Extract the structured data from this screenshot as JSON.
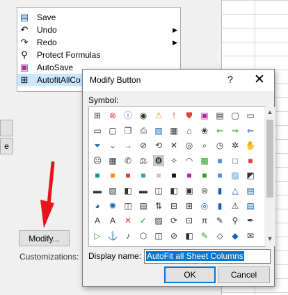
{
  "commands": [
    {
      "label": "Save",
      "icon": "save-icon"
    },
    {
      "label": "Undo",
      "icon": "undo-icon"
    },
    {
      "label": "Redo",
      "icon": "redo-icon"
    },
    {
      "label": "Protect Formulas",
      "icon": "protect-formulas-icon"
    },
    {
      "label": "AutoSave",
      "icon": "autosave-icon"
    },
    {
      "label": "AutofitAllCo",
      "icon": "flowchart-icon"
    }
  ],
  "side_button_label": "e",
  "modify_label": "Modify...",
  "customizations_label": "Customizations:",
  "dialog": {
    "title": "Modify Button",
    "help": "?",
    "close": "✕",
    "symbol_label": "Symbol:",
    "display_name_label": "Display name:",
    "display_name_value": "AutoFit all Sheet Columns",
    "ok_label": "OK",
    "cancel_label": "Cancel"
  },
  "symbols": [
    {
      "g": "⊞",
      "c": "#333"
    },
    {
      "g": "⊗",
      "c": "#e04040"
    },
    {
      "g": "ⓘ",
      "c": "#1a5fb4"
    },
    {
      "g": "◉",
      "c": "#333"
    },
    {
      "g": "⚠",
      "c": "#d9a400"
    },
    {
      "g": "!",
      "c": "#e04040"
    },
    {
      "g": "⛊",
      "c": "#e04040"
    },
    {
      "g": "▣",
      "c": "#b0289a"
    },
    {
      "g": "▤",
      "c": "#333"
    },
    {
      "g": "▢",
      "c": "#333"
    },
    {
      "g": "▭",
      "c": "#333"
    },
    {
      "g": "▭",
      "c": "#333"
    },
    {
      "g": "▢",
      "c": "#333"
    },
    {
      "g": "❐",
      "c": "#333"
    },
    {
      "g": "⎙",
      "c": "#333"
    },
    {
      "g": "▧",
      "c": "#1a5fb4"
    },
    {
      "g": "▦",
      "c": "#333"
    },
    {
      "g": "⌂",
      "c": "#333"
    },
    {
      "g": "❀",
      "c": "#333"
    },
    {
      "g": "⇐",
      "c": "#2aa02a"
    },
    {
      "g": "⇒",
      "c": "#2aa02a"
    },
    {
      "g": "⇐",
      "c": "#1a5fb4"
    },
    {
      "g": "⏷",
      "c": "#1a5fb4"
    },
    {
      "g": "⌄",
      "c": "#1a5fb4"
    },
    {
      "g": "→",
      "c": "#1a5fb4"
    },
    {
      "g": "⊘",
      "c": "#333"
    },
    {
      "g": "⟲",
      "c": "#333"
    },
    {
      "g": "✕",
      "c": "#333"
    },
    {
      "g": "◎",
      "c": "#333"
    },
    {
      "g": "⌕",
      "c": "#333"
    },
    {
      "g": "◷",
      "c": "#333"
    },
    {
      "g": "✲",
      "c": "#333"
    },
    {
      "g": "✋",
      "c": "#333"
    },
    {
      "g": "☹",
      "c": "#333"
    },
    {
      "g": "▦",
      "c": "#333"
    },
    {
      "g": "✆",
      "c": "#333"
    },
    {
      "g": "⚖",
      "c": "#333"
    },
    {
      "g": "❽",
      "c": "#333"
    },
    {
      "g": "✧",
      "c": "#333"
    },
    {
      "g": "◠",
      "c": "#333"
    },
    {
      "g": "▩",
      "c": "#2aa02a"
    },
    {
      "g": "■",
      "c": "#4a90d9"
    },
    {
      "g": "□",
      "c": "#333"
    },
    {
      "g": "■",
      "c": "#e04040"
    },
    {
      "g": "■",
      "c": "#1a9a6a"
    },
    {
      "g": "■",
      "c": "#f08c00"
    },
    {
      "g": "■",
      "c": "#e04040"
    },
    {
      "g": "■",
      "c": "#3aa0a0"
    },
    {
      "g": "■",
      "c": "#c8c8c8"
    },
    {
      "g": "■",
      "c": "#111"
    },
    {
      "g": "■",
      "c": "#b0289a"
    },
    {
      "g": "■",
      "c": "#2aa02a"
    },
    {
      "g": "■",
      "c": "#4a90d9"
    },
    {
      "g": "▨",
      "c": "#4a90d9"
    },
    {
      "g": "◩",
      "c": "#333"
    },
    {
      "g": "▬",
      "c": "#333"
    },
    {
      "g": "▨",
      "c": "#333"
    },
    {
      "g": "◧",
      "c": "#333"
    },
    {
      "g": "▬",
      "c": "#333"
    },
    {
      "g": "◫",
      "c": "#333"
    },
    {
      "g": "◧",
      "c": "#333"
    },
    {
      "g": "▣",
      "c": "#333"
    },
    {
      "g": "⊜",
      "c": "#333"
    },
    {
      "g": "▮",
      "c": "#1a5fb4"
    },
    {
      "g": "△",
      "c": "#1a5fb4"
    },
    {
      "g": "▤",
      "c": "#1a5fb4"
    },
    {
      "g": "◕",
      "c": "#1a5fb4"
    },
    {
      "g": "✺",
      "c": "#1a5fb4"
    },
    {
      "g": "◫",
      "c": "#333"
    },
    {
      "g": "▤",
      "c": "#333"
    },
    {
      "g": "⇅",
      "c": "#333"
    },
    {
      "g": "⊟",
      "c": "#333"
    },
    {
      "g": "⊞",
      "c": "#333"
    },
    {
      "g": "◎",
      "c": "#1a5fb4"
    },
    {
      "g": "▮",
      "c": "#1a5fb4"
    },
    {
      "g": "⚠",
      "c": "#333"
    },
    {
      "g": "▤",
      "c": "#1a5fb4"
    },
    {
      "g": "A",
      "c": "#333"
    },
    {
      "g": "A",
      "c": "#333"
    },
    {
      "g": "✕",
      "c": "#e04040"
    },
    {
      "g": "✓",
      "c": "#2aa02a"
    },
    {
      "g": "▨",
      "c": "#333"
    },
    {
      "g": "⟳",
      "c": "#333"
    },
    {
      "g": "⊡",
      "c": "#333"
    },
    {
      "g": "π",
      "c": "#333"
    },
    {
      "g": "✎",
      "c": "#333"
    },
    {
      "g": "⚲",
      "c": "#333"
    },
    {
      "g": "✒",
      "c": "#333"
    },
    {
      "g": "▷",
      "c": "#2aa02a"
    },
    {
      "g": "⚓",
      "c": "#1a5fb4"
    },
    {
      "g": "♪",
      "c": "#333"
    },
    {
      "g": "⬡",
      "c": "#333"
    },
    {
      "g": "◫",
      "c": "#333"
    },
    {
      "g": "⊘",
      "c": "#333"
    },
    {
      "g": "◧",
      "c": "#333"
    },
    {
      "g": "✎",
      "c": "#2aa02a"
    },
    {
      "g": "◇",
      "c": "#333"
    },
    {
      "g": "◆",
      "c": "#1a5fb4"
    },
    {
      "g": "✉",
      "c": "#333"
    }
  ]
}
